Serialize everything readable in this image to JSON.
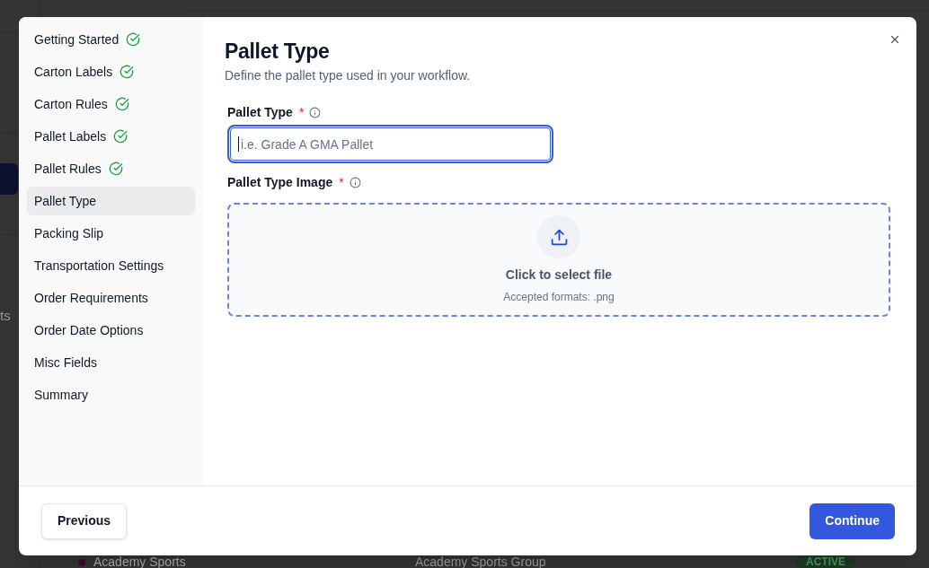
{
  "background": {
    "side_texts": [
      "ts"
    ],
    "row": {
      "name": "Academy Sports",
      "color": "#3a0b35",
      "group": "Academy Sports Group",
      "status": "ACTIVE"
    }
  },
  "dialog": {
    "steps": [
      {
        "label": "Getting Started",
        "completed": true,
        "selected": false
      },
      {
        "label": "Carton Labels",
        "completed": true,
        "selected": false
      },
      {
        "label": "Carton Rules",
        "completed": true,
        "selected": false
      },
      {
        "label": "Pallet Labels",
        "completed": true,
        "selected": false
      },
      {
        "label": "Pallet Rules",
        "completed": true,
        "selected": false
      },
      {
        "label": "Pallet Type",
        "completed": false,
        "selected": true
      },
      {
        "label": "Packing Slip",
        "completed": false,
        "selected": false
      },
      {
        "label": "Transportation Settings",
        "completed": false,
        "selected": false
      },
      {
        "label": "Order Requirements",
        "completed": false,
        "selected": false
      },
      {
        "label": "Order Date Options",
        "completed": false,
        "selected": false
      },
      {
        "label": "Misc Fields",
        "completed": false,
        "selected": false
      },
      {
        "label": "Summary",
        "completed": false,
        "selected": false
      }
    ],
    "title": "Pallet Type",
    "description": "Define the pallet type used in your workflow.",
    "fields": [
      {
        "kind": "text",
        "label": "Pallet Type",
        "required_mark": "*",
        "placeholder": "i.e. Grade A GMA Pallet",
        "focused": true
      },
      {
        "kind": "upload",
        "label": "Pallet Type Image",
        "required_mark": "*",
        "prompt": "Click to select file",
        "hint": "Accepted formats: .png"
      }
    ],
    "buttons": [
      {
        "label": "Previous",
        "kind": "secondary"
      },
      {
        "label": "Continue",
        "kind": "primary"
      }
    ]
  }
}
